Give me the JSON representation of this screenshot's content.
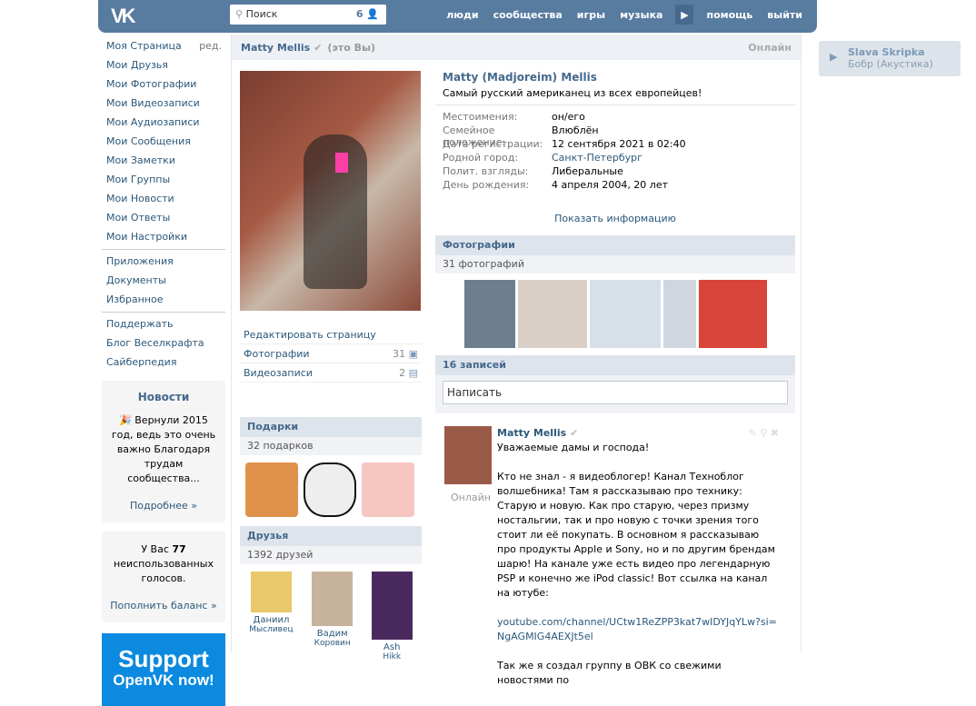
{
  "header": {
    "logo": "VK",
    "search_placeholder": "Поиск",
    "search_count": "6",
    "nav": [
      "люди",
      "сообщества",
      "игры",
      "музыка",
      "помощь",
      "выйти"
    ]
  },
  "left_nav": {
    "items": [
      "Моя Страница",
      "Мои Друзья",
      "Мои Фотографии",
      "Мои Видеозаписи",
      "Мои Аудиозаписи",
      "Мои Сообщения",
      "Мои Заметки",
      "Мои Группы",
      "Мои Новости",
      "Мои Ответы",
      "Мои Настройки"
    ],
    "edit": "ред.",
    "items2": [
      "Приложения",
      "Документы",
      "Избранное"
    ],
    "items3": [
      "Поддержать",
      "Блог Веселкрафта",
      "Сайберпедия"
    ],
    "news": {
      "title": "Новости",
      "text": "🎉 Вернули 2015 год, ведь это очень важно Благодаря трудам сообщества...",
      "more": "Подробнее »"
    },
    "votes": {
      "pre": "У Вас ",
      "count": "77",
      "post": " неиспользованных голосов.",
      "link": "Пополнить баланс »"
    },
    "support": {
      "line1": "Support",
      "line2": "OpenVK now!"
    }
  },
  "profile": {
    "header_name": "Matty Mellis",
    "header_you": "(это Вы)",
    "header_online": "Онлайн",
    "full_name": "Matty (Madjoreim) Mellis",
    "status": "Самый русский американец из всех европейцев!",
    "info": [
      {
        "k": "Местоимения:",
        "v": "он/его"
      },
      {
        "k": "Семейное положение:",
        "v": "Влюблён"
      },
      {
        "k": "Дата регистрации:",
        "v": "12 сентября 2021 в 02:40"
      },
      {
        "k": "Родной город:",
        "v": "Санкт-Петербург"
      },
      {
        "k": "Полит. взгляды:",
        "v": "Либеральные"
      },
      {
        "k": "День рождения:",
        "v": "4 апреля 2004, 20 лет"
      }
    ],
    "show_info": "Показать информацию",
    "edit_page": "Редактировать страницу",
    "photos_label": "Фотографии",
    "photos_count": "31",
    "videos_label": "Видеозаписи",
    "videos_count": "2"
  },
  "gifts": {
    "title": "Подарки",
    "count": "32 подарков"
  },
  "friends": {
    "title": "Друзья",
    "count": "1392 друзей",
    "list": [
      {
        "first": "Даниил",
        "last": "Мысливец"
      },
      {
        "first": "Вадим",
        "last": "Коровин"
      },
      {
        "first": "Ash",
        "last": "Hikk"
      }
    ]
  },
  "photos": {
    "title": "Фотографии",
    "count": "31 фотографий"
  },
  "wall": {
    "title": "16 записей",
    "placeholder": "Написать",
    "post": {
      "author": "Matty Mellis",
      "online": "Онлайн",
      "p1": "Уважаемые дамы и господа!",
      "p2": "Кто не знал - я видеоблогер! Канал Техноблог волшебника! Там я рассказываю про технику: Старую и новую. Как про старую, через призму ностальгии, так и про новую с точки зрения того стоит ли её покупать. В основном я рассказываю про продукты Apple и Sony, но и по другим брендам шарю! На канале уже есть видео про легендарную PSP и конечно же iPod classic! Вот ссылка на канал на ютубе:",
      "link": "youtube.com/channel/UCtw1ReZPP3kat7wIDYJqYLw?si=NgAGMIG4AEXJt5el",
      "p3": "Так же я создал группу в ОВК со свежими новостями по"
    }
  },
  "player": {
    "artist": "Slava Skripka",
    "track": "Бобр (Акустика)"
  }
}
